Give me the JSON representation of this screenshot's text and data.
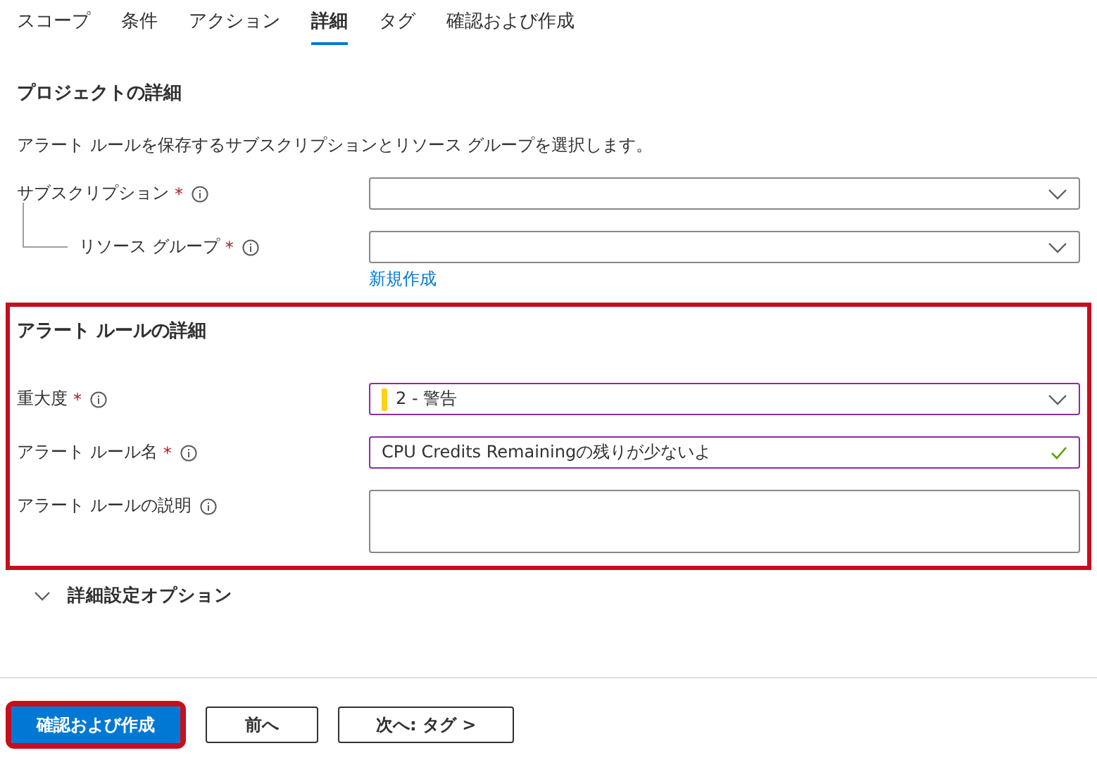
{
  "tabs": [
    {
      "label": "スコープ",
      "selected": false
    },
    {
      "label": "条件",
      "selected": false
    },
    {
      "label": "アクション",
      "selected": false
    },
    {
      "label": "詳細",
      "selected": true
    },
    {
      "label": "タグ",
      "selected": false
    },
    {
      "label": "確認および作成",
      "selected": false
    }
  ],
  "project": {
    "title": "プロジェクトの詳細",
    "description": "アラート ルールを保存するサブスクリプションとリソース グループを選択します。",
    "fields": [
      {
        "label": "サブスクリプション",
        "asterisk": "*",
        "kind": "dropdown",
        "indented": false,
        "edited": false
      },
      {
        "label": "リソース グループ",
        "asterisk": "*",
        "kind": "dropdown",
        "indented": true,
        "edited": false,
        "link": "新規作成"
      }
    ]
  },
  "rule": {
    "title": "アラート ルールの詳細",
    "highlighted": true,
    "fields": [
      {
        "label": "重大度",
        "asterisk": "*",
        "kind": "dropdown",
        "edited": true,
        "value": "2 - 警告",
        "color": "#fcd116"
      },
      {
        "label": "アラート ルール名",
        "asterisk": "*",
        "kind": "text",
        "edited": true,
        "value": "CPU Credits Remainingの残りが少ないよ",
        "valid": true
      },
      {
        "label": "アラート ルールの説明",
        "kind": "textarea",
        "edited": false
      }
    ]
  },
  "advanced": {
    "label": "詳細設定オプション",
    "expanded": false
  },
  "buttons": [
    {
      "label": "確認および作成",
      "kind": "primary",
      "highlighted": true
    },
    {
      "label": "前へ",
      "kind": "secondary",
      "highlighted": false
    },
    {
      "label": "次へ: タグ >",
      "kind": "secondary",
      "highlighted": false
    }
  ]
}
